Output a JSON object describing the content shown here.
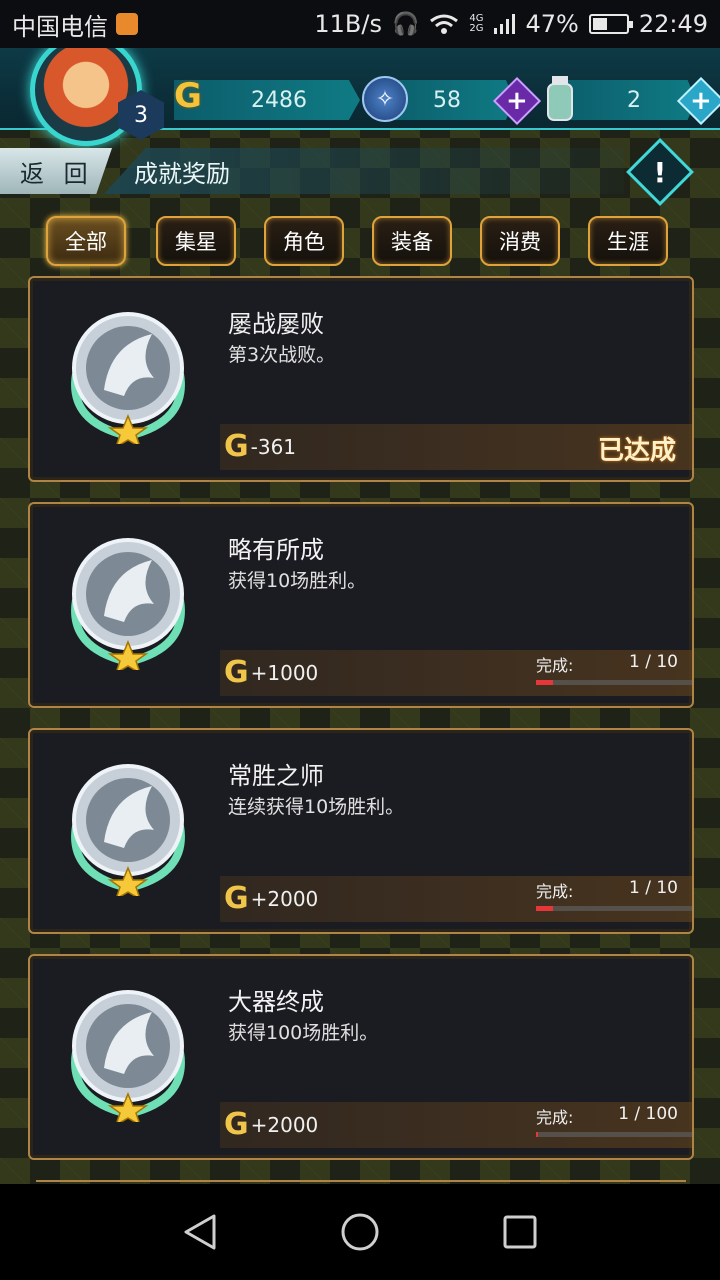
{
  "status_bar": {
    "carrier": "中国电信",
    "net_speed": "11B/s",
    "net_type_top": "4G",
    "net_type_bottom": "2G",
    "battery": "47%",
    "time": "22:49"
  },
  "player": {
    "level": "3",
    "gold": "2486",
    "crystal": "58",
    "stamina": "2"
  },
  "header": {
    "back_label": "返 回",
    "title": "成就奖励"
  },
  "tabs": [
    {
      "label": "全部",
      "active": true
    },
    {
      "label": "集星"
    },
    {
      "label": "角色"
    },
    {
      "label": "装备"
    },
    {
      "label": "消费"
    },
    {
      "label": "生涯"
    }
  ],
  "achievements": [
    {
      "title": "屡战屡败",
      "desc": "第3次战败。",
      "reward": "-361",
      "status": "已达成"
    },
    {
      "title": "略有所成",
      "desc": "获得10场胜利。",
      "reward": "+1000",
      "progress_label": "完成:",
      "progress_text": "1 / 10",
      "progress": 0.1
    },
    {
      "title": "常胜之师",
      "desc": "连续获得10场胜利。",
      "reward": "+2000",
      "progress_label": "完成:",
      "progress_text": "1 / 10",
      "progress": 0.1
    },
    {
      "title": "大器终成",
      "desc": "获得100场胜利。",
      "reward": "+2000",
      "progress_label": "完成:",
      "progress_text": "1 / 100",
      "progress": 0.01
    }
  ],
  "icons": {
    "gold": "G",
    "plus": "+",
    "warning": "!"
  },
  "colors": {
    "accent": "#39d6d0",
    "tab_border": "#e0a33c",
    "progress": "#e6363a",
    "crystal_plus": "#6a2aa8",
    "stamina_plus": "#2aa7c8"
  }
}
